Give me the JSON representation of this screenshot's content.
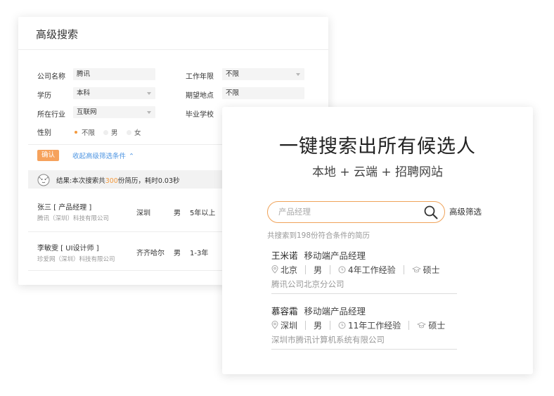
{
  "back": {
    "title": "高级搜索",
    "fields": {
      "company_label": "公司名称",
      "company_value": "腾讯",
      "edu_label": "学历",
      "edu_value": "本科",
      "industry_label": "所在行业",
      "industry_value": "互联网",
      "gender_label": "性别",
      "years_label": "工作年限",
      "years_value": "不限",
      "location_label": "期望地点",
      "location_value": "不限",
      "school_label": "毕业学校"
    },
    "gender_options": [
      "不限",
      "男",
      "女"
    ],
    "gender_selected": "不限",
    "confirm_label": "确认",
    "collapse_label": "收起高级筛选条件",
    "result": {
      "prefix": "结果:本次搜索共",
      "count": "300",
      "suffix": "份简历，耗时0.03秒"
    },
    "rows": [
      {
        "name": "张三 [ 产品经理 ]",
        "company": "腾讯（深圳）科技有限公司",
        "city": "深圳",
        "gender": "男",
        "years": "5年以上"
      },
      {
        "name": "李敏雯 [ UI设计师 ]",
        "company": "珍爱网（深圳）科技有限公司",
        "city": "齐齐哈尔",
        "gender": "男",
        "years": "1-3年"
      }
    ]
  },
  "front": {
    "headline": "一键搜索出所有候选人",
    "subline": "本地 + 云端 + 招聘网站",
    "search": {
      "placeholder": "产品经理"
    },
    "advanced_label": "高级筛选",
    "count_text": "共搜索到198份符合条件的简历",
    "candidates": [
      {
        "name": "王米诺",
        "position": "移动端产品经理",
        "city": "北京",
        "gender": "男",
        "experience": "4年工作经验",
        "degree": "硕士",
        "company": "腾讯公司北京分公司"
      },
      {
        "name": "慕容霜",
        "position": "移动端产品经理",
        "city": "深圳",
        "gender": "男",
        "experience": "11年工作经验",
        "degree": "硕士",
        "company": "深圳市腾讯计算机系统有限公司"
      }
    ]
  },
  "colors": {
    "accent": "#f39a3e",
    "link": "#4e95e2",
    "confirm_bg": "#f6a25c"
  }
}
